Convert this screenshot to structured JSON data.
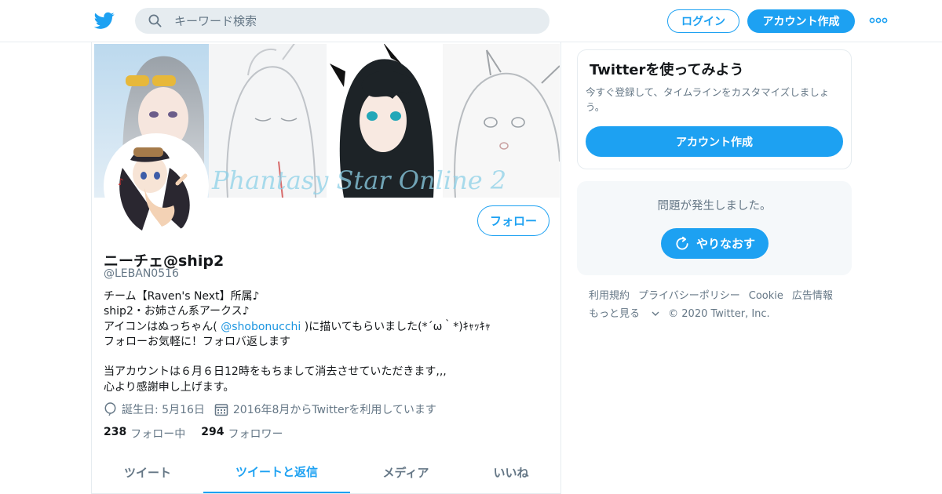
{
  "header": {
    "search_placeholder": "キーワード検索",
    "login_label": "ログイン",
    "signup_label": "アカウント作成"
  },
  "profile": {
    "name": "ニーチェ@ship2",
    "handle": "@LEBAN0516",
    "follow_label": "フォロー",
    "bio": {
      "line1": "チーム【Raven's Next】所属♪",
      "line2": "ship2・お姉さん系アークス♪",
      "line3_pre": "アイコンはぬっちゃん( ",
      "line3_link": "@shobonucchi",
      "line3_post": " )に描いてもらいました(*´ω｀*)ｷｬｯｷｬ",
      "line4": "フォローお気軽に！フォロバ返します",
      "line5": "当アカウントは６月６日12時をもちまして消去させていただきます,,,",
      "line6": "心より感謝申し上げます。"
    },
    "birthday": "誕生日: 5月16日",
    "joined": "2016年8月からTwitterを利用しています",
    "following_count": "238",
    "following_label": "フォロー中",
    "followers_count": "294",
    "followers_label": "フォロワー",
    "tabs": [
      {
        "label": "ツイート"
      },
      {
        "label": "ツイートと返信"
      },
      {
        "label": "メディア"
      },
      {
        "label": "いいね"
      }
    ],
    "active_tab_index": 1,
    "banner_text": "Phantasy Star Online 2"
  },
  "sidebar": {
    "card_title": "Twitterを使ってみよう",
    "card_text": "今すぐ登録して、タイムラインをカスタマイズしましょう。",
    "card_cta": "アカウント作成",
    "error_text": "問題が発生しました。",
    "retry_label": "やりなおす"
  },
  "footer": {
    "links": [
      "利用規約",
      "プライバシーポリシー",
      "Cookie",
      "広告情報"
    ],
    "more": "もっと見る",
    "copyright": "© 2020 Twitter, Inc."
  },
  "colors": {
    "accent": "#1da1f2",
    "secondary_text": "#657786",
    "border": "#e6ecf0"
  }
}
